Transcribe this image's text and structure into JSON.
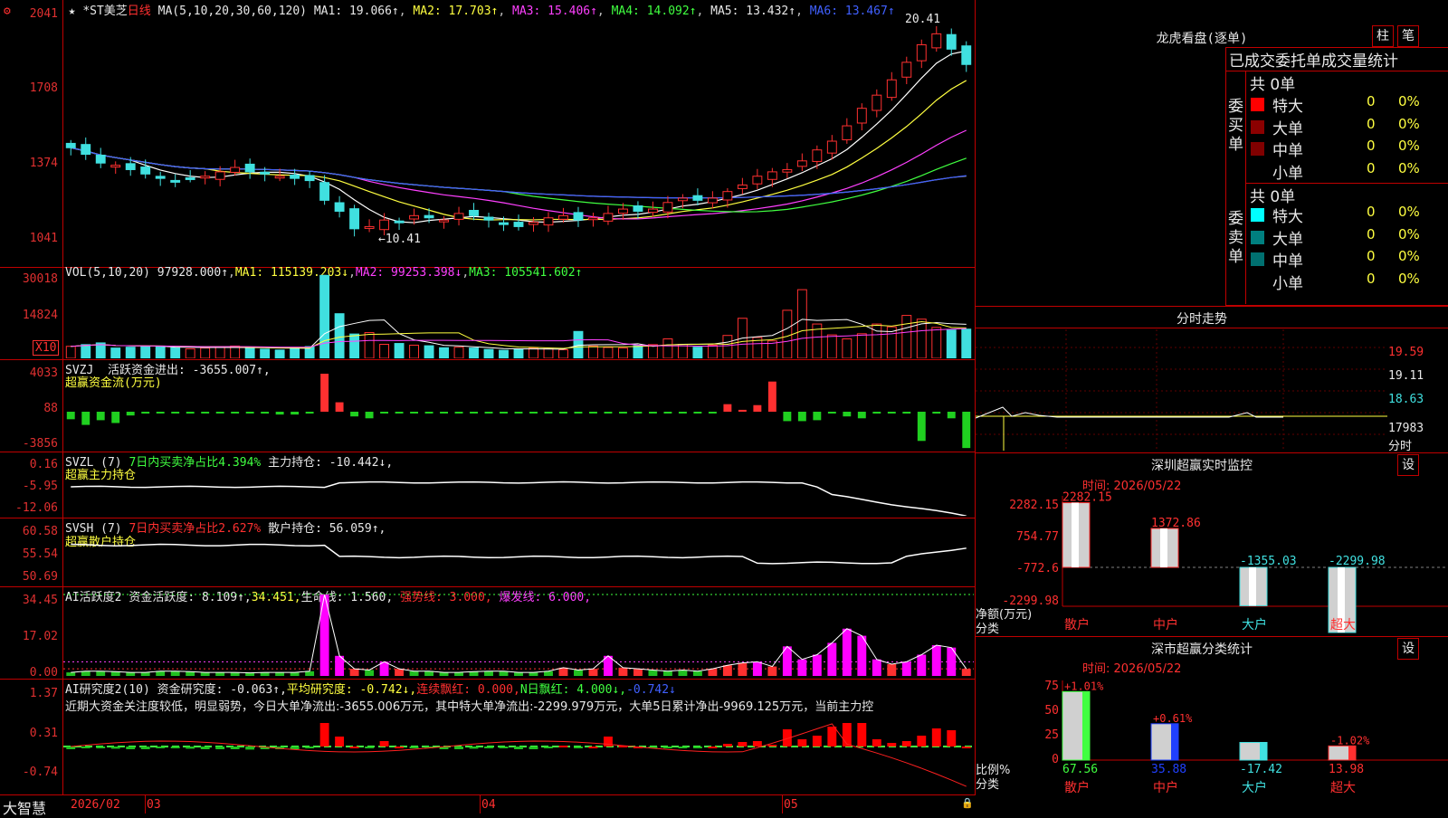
{
  "colors": {
    "up": "#ff3030",
    "down": "#40e0e0",
    "ma1": "#ffffff",
    "ma2": "#ffff40",
    "ma3": "#ff40ff",
    "ma4": "#40ff40",
    "ma5": "#b0b0b0",
    "ma6": "#4060ff",
    "grid": "#c00000"
  },
  "toolbar": {
    "star_icon": "★",
    "settings_icon": "⚙"
  },
  "main": {
    "title": "*ST美芝",
    "period": "日线",
    "ma_label": "MA(5,10,20,30,60,120)",
    "ma1": "MA1: 19.066↑",
    "ma2": "MA2: 17.703↑",
    "ma3": "MA3: 15.406↑",
    "ma4": "MA4: 14.092↑",
    "ma5": "MA5: 13.432↑",
    "ma6": "MA6: 13.467↑",
    "y_ticks": [
      "2041",
      "1708",
      "1374",
      "1041"
    ],
    "high_note": "20.41",
    "low_note": "10.41"
  },
  "vol": {
    "label": "VOL(5,10,20)",
    "value": "97928.000↑",
    "ma1": "MA1: 115139.203↓",
    "ma2": "MA2: 99253.398↓",
    "ma3": "MA3: 105541.602↑",
    "y_ticks": [
      "30018",
      "14824"
    ],
    "unit": "X10"
  },
  "svzj": {
    "label": "SVZJ",
    "line1": "活跃资金进出: -3655.007↑,",
    "line2": "超赢资金流(万元)",
    "y_ticks": [
      "4033",
      "88",
      "-3856"
    ]
  },
  "svzl": {
    "label": "SVZL (7)",
    "a": "7日内买卖净占比4.394%",
    "b": "主力持仓: -10.442↓,",
    "line2": "超赢主力持仓",
    "y_ticks": [
      "0.16",
      "-5.95",
      "-12.06"
    ]
  },
  "svsh": {
    "label": "SVSH (7)",
    "a": "7日内买卖净占比2.627%",
    "b": "散户持仓: 56.059↑,",
    "line2": "超赢散户持仓",
    "y_ticks": [
      "60.58",
      "55.54",
      "50.69"
    ]
  },
  "ai1": {
    "label": "AI活跃度2",
    "a": "资金活跃度: 8.109↑,",
    "b": "34.451,",
    "c": "生命线: 1.560,",
    "d": "强势线: 3.000,",
    "e": "爆发线: 6.000,",
    "y_ticks": [
      "34.45",
      "17.02",
      "0.00"
    ]
  },
  "ai2": {
    "label": "AI研究度2(10)",
    "a": "资金研究度: -0.063↑,",
    "b": "平均研究度: -0.742↓,",
    "c": "连续飘红: 0.000,",
    "d": "N日飘红: 4.000↓,",
    "e": "-0.742↓",
    "note": "近期大资金关注度较低，明显弱势，今日大单净流出:-3655.006万元，其中特大单净流出:-2299.979万元，大单5日累计净出-9969.125万元，当前主力控",
    "y_ticks": [
      "1.37",
      "0.31",
      "-0.74"
    ]
  },
  "xaxis": {
    "brand": "大智慧",
    "labels": [
      "2026/02",
      "03",
      "04",
      "05"
    ]
  },
  "dragon": {
    "title": "龙虎看盘(逐单)",
    "btn1": "柱",
    "btn2": "笔",
    "subtitle": "已成交委托单成交量统计",
    "buy": {
      "side": "委买单",
      "total": "共 0单",
      "rows": [
        {
          "label": "特大",
          "v": "0",
          "p": "0%",
          "color": "#ff0000"
        },
        {
          "label": "大单",
          "v": "0",
          "p": "0%",
          "color": "#8b0000"
        },
        {
          "label": "中单",
          "v": "0",
          "p": "0%",
          "color": "#800000"
        },
        {
          "label": "小单",
          "v": "0",
          "p": "0%",
          "color": ""
        }
      ]
    },
    "sell": {
      "side": "委卖单",
      "total": "共 0单",
      "rows": [
        {
          "label": "特大",
          "v": "0",
          "p": "0%",
          "color": "#00ffff"
        },
        {
          "label": "大单",
          "v": "0",
          "p": "0%",
          "color": "#008080"
        },
        {
          "label": "中单",
          "v": "0",
          "p": "0%",
          "color": "#007070"
        },
        {
          "label": "小单",
          "v": "0",
          "p": "0%",
          "color": ""
        }
      ]
    }
  },
  "minute": {
    "title": "分时走势",
    "y_ticks": [
      "19.59",
      "19.11",
      "18.63",
      "17983"
    ],
    "unit": "分时"
  },
  "szmon": {
    "title": "深圳超赢实时监控",
    "btn": "设",
    "time": "时间: 2026/05/22",
    "y_ticks": [
      "2282.15",
      "754.77",
      "-772.6",
      "-2299.98"
    ],
    "axis_label": "净额(万元)",
    "cat_label": "分类",
    "bars": [
      {
        "cat": "散户",
        "value": 2282.15,
        "label": "2282.15"
      },
      {
        "cat": "中户",
        "value": 1372.86,
        "label": "1372.86"
      },
      {
        "cat": "大户",
        "value": -1355.03,
        "label": "-1355.03"
      },
      {
        "cat": "超大",
        "value": -2299.98,
        "label": "-2299.98"
      }
    ]
  },
  "szcls": {
    "title": "深市超赢分类统计",
    "btn": "设",
    "time": "时间: 2026/05/22",
    "y_ticks": [
      "75",
      "50",
      "25",
      "0"
    ],
    "axis_label": "比例%",
    "cat_label": "分类",
    "bars": [
      {
        "cat": "散户",
        "value": 67.56,
        "pct": "+1.01%",
        "label": "67.56",
        "color": "#40ff40"
      },
      {
        "cat": "中户",
        "value": 35.88,
        "pct": "+0.61%",
        "label": "35.88",
        "color": "#2040ff"
      },
      {
        "cat": "大户",
        "value": -17.42,
        "pct": "",
        "label": "-17.42",
        "color": "#40e0e0"
      },
      {
        "cat": "超大",
        "value": 13.98,
        "pct": "-1.02%",
        "label": "13.98",
        "color": "#ff3030"
      }
    ]
  },
  "chart_data": {
    "type": "candlestick",
    "ma_lines": [
      "MA1",
      "MA2",
      "MA3",
      "MA4",
      "MA5",
      "MA6"
    ],
    "y_range": [
      10.41,
      20.41
    ],
    "closes": [
      14.9,
      14.6,
      14.2,
      14.1,
      13.9,
      13.7,
      13.5,
      13.4,
      13.5,
      13.6,
      13.8,
      14.0,
      13.8,
      13.7,
      13.6,
      13.5,
      13.4,
      12.5,
      12.0,
      11.2,
      11.3,
      11.6,
      11.5,
      11.8,
      11.7,
      11.6,
      11.9,
      11.8,
      11.6,
      11.4,
      11.3,
      11.5,
      11.7,
      11.8,
      11.6,
      11.7,
      11.9,
      12.1,
      12.0,
      12.1,
      12.4,
      12.6,
      12.5,
      12.6,
      12.9,
      13.2,
      13.6,
      13.8,
      13.9,
      14.3,
      14.8,
      15.2,
      15.9,
      16.7,
      17.3,
      18.0,
      18.8,
      19.6,
      20.1,
      19.4,
      18.7
    ],
    "volumes": [
      4200,
      4800,
      5400,
      3600,
      3900,
      4100,
      4300,
      3700,
      3300,
      3600,
      4000,
      4300,
      3500,
      3200,
      2900,
      3800,
      4100,
      29000,
      15600,
      8500,
      9000,
      4900,
      5200,
      4600,
      4400,
      3700,
      3900,
      3600,
      3100,
      2800,
      3300,
      3600,
      3400,
      3000,
      9400,
      4300,
      3800,
      3600,
      4400,
      4800,
      6800,
      4900,
      3900,
      4600,
      8000,
      14000,
      7300,
      6100,
      16800,
      24000,
      12000,
      8200,
      6800,
      8600,
      12000,
      11000,
      15000,
      13700,
      10800,
      9900,
      10200
    ],
    "svzj": [
      -800,
      -1400,
      -900,
      -1200,
      -400,
      -200,
      -100,
      -100,
      -200,
      -100,
      -100,
      -100,
      -100,
      -200,
      -300,
      -300,
      -200,
      4033,
      1000,
      -500,
      -700,
      -100,
      -100,
      -100,
      -100,
      -100,
      -100,
      -100,
      -100,
      -100,
      -100,
      -100,
      -100,
      -100,
      -100,
      -100,
      -100,
      -100,
      -100,
      -100,
      -100,
      -100,
      -100,
      -100,
      800,
      200,
      700,
      3200,
      -1000,
      -1000,
      -900,
      -100,
      -500,
      -700,
      -200,
      -100,
      -200,
      -3100,
      -200,
      -700,
      -3855
    ],
    "ai1": [
      1.5,
      2,
      2,
      1.8,
      1.5,
      1.5,
      2,
      2,
      1.8,
      1.5,
      1.5,
      1.5,
      1.3,
      1.5,
      1.5,
      1.5,
      2,
      34.45,
      8.5,
      3,
      2.5,
      6,
      3,
      2,
      2,
      1.5,
      1.5,
      1.8,
      2,
      2,
      1.5,
      1.5,
      2,
      3.5,
      2.5,
      3,
      8.5,
      3.5,
      3,
      2.5,
      2,
      2.5,
      2,
      3,
      4.5,
      5.5,
      6,
      4,
      12.5,
      7,
      9,
      14,
      20,
      17,
      7,
      5,
      6,
      9,
      13,
      12,
      3
    ]
  }
}
